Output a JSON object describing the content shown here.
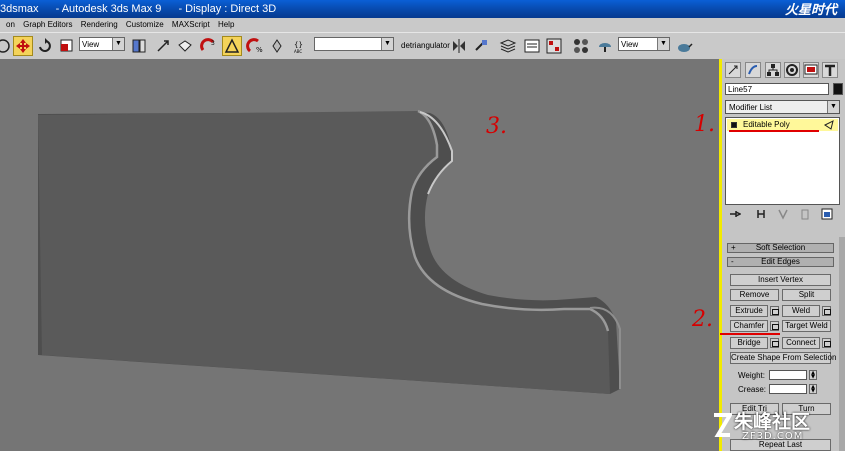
{
  "title_bar": {
    "parts": [
      "3dsmax",
      "- Autodesk 3ds Max 9",
      "- Display : Direct 3D"
    ],
    "brand": "火星时代"
  },
  "menu": [
    "on",
    "Graph Editors",
    "Rendering",
    "Customize",
    "MAXScript",
    "Help"
  ],
  "toolbar": {
    "ref_coord": "View",
    "named_selection": "",
    "plugin_label": "detriangulator",
    "render_view": "View"
  },
  "command_panel": {
    "object_name": "Line57",
    "object_color": "#111111",
    "modifier_list": "Modifier List",
    "stack_item": "Editable Poly",
    "rollouts": {
      "soft_selection": {
        "sign": "+",
        "label": "Soft Selection"
      },
      "edit_edges": {
        "sign": "-",
        "label": "Edit Edges"
      }
    },
    "buttons": {
      "insert_vertex": "Insert Vertex",
      "remove": "Remove",
      "split": "Split",
      "extrude": "Extrude",
      "weld": "Weld",
      "chamfer": "Chamfer",
      "target_weld": "Target Weld",
      "bridge": "Bridge",
      "connect": "Connect",
      "create_shape": "Create Shape From Selection",
      "edit_tri": "Edit Tri",
      "turn": "Turn",
      "repeat_last": "Repeat Last"
    },
    "weight_label": "Weight:",
    "crease_label": "Crease:"
  },
  "annotations": [
    "1.",
    "2.",
    "3."
  ],
  "watermark": {
    "brand": "朱峰社区",
    "url": "ZF3D.COM"
  },
  "colors": {
    "viewport_border": "#f2ea00",
    "annotation": "#d60000",
    "active_tool": "#f4d35a",
    "highlight_item": "#fff89a"
  }
}
